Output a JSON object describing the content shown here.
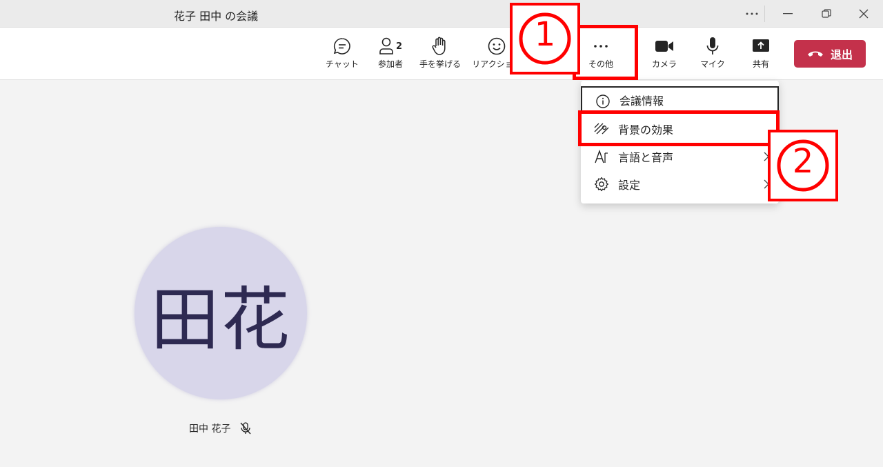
{
  "window": {
    "title": "花子 田中 の会議"
  },
  "toolbar": {
    "chat": "チャット",
    "participants": "参加者",
    "participants_count": "2",
    "raise_hand": "手を挙げる",
    "reactions": "リアクション",
    "more": "その他",
    "camera": "カメラ",
    "mic": "マイク",
    "share": "共有",
    "leave": "退出"
  },
  "menu": {
    "items": [
      {
        "label": "会議情報",
        "icon": "info-icon"
      },
      {
        "label": "背景の効果",
        "icon": "background-effects-icon"
      },
      {
        "label": "言語と音声",
        "icon": "language-speech-icon"
      },
      {
        "label": "設定",
        "icon": "settings-icon"
      }
    ]
  },
  "annotations": {
    "step1": "①",
    "step2": "②"
  },
  "participant": {
    "initials": "田花",
    "name": "田中 花子"
  },
  "colors": {
    "leave": "#c4314b",
    "annotation": "#ff0000",
    "avatar_bg": "#d8d6ea",
    "avatar_text": "#2e2a52"
  }
}
